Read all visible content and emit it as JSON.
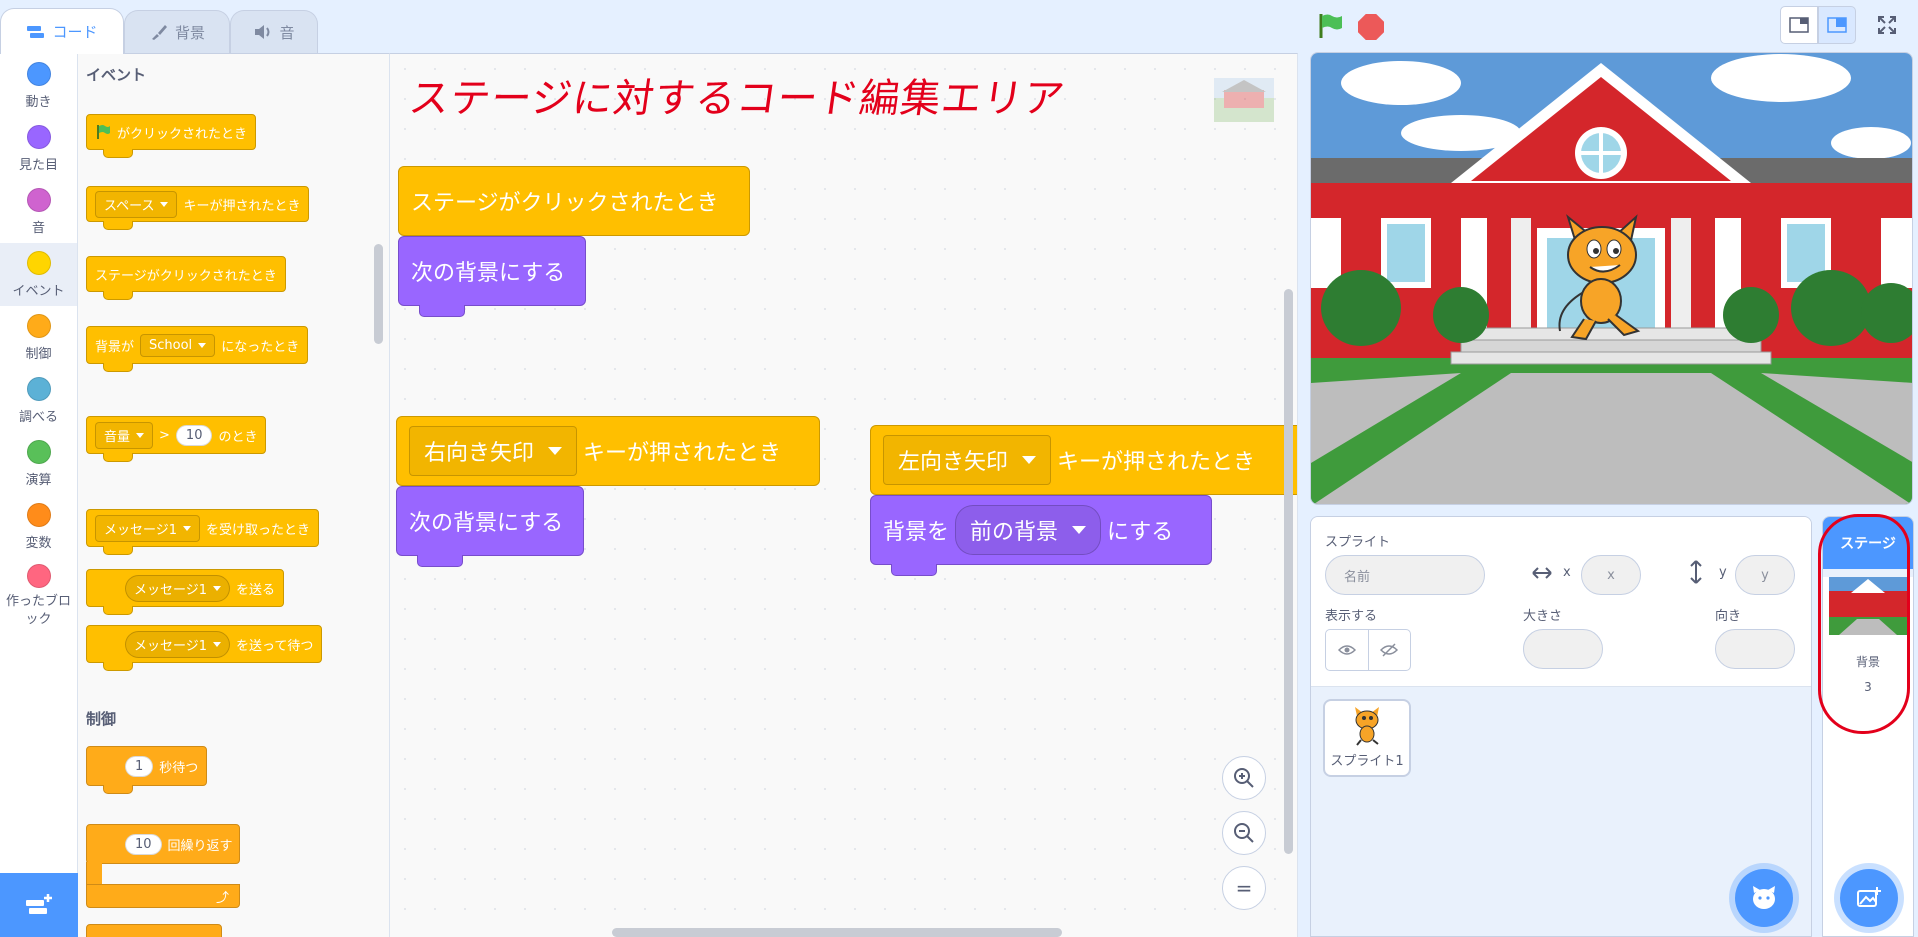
{
  "tabs": [
    {
      "label": "コード",
      "icon": "code-icon",
      "active": true
    },
    {
      "label": "背景",
      "icon": "brush-icon",
      "active": false
    },
    {
      "label": "音",
      "icon": "speaker-icon",
      "active": false
    }
  ],
  "categories": [
    {
      "label": "動き",
      "color": "#4c97ff"
    },
    {
      "label": "見た目",
      "color": "#9966ff"
    },
    {
      "label": "音",
      "color": "#cf63cf"
    },
    {
      "label": "イベント",
      "color": "#ffd500"
    },
    {
      "label": "制御",
      "color": "#ffab19"
    },
    {
      "label": "調べる",
      "color": "#5cb1d6"
    },
    {
      "label": "演算",
      "color": "#59c059"
    },
    {
      "label": "変数",
      "color": "#ff8c1a"
    },
    {
      "label": "作ったブロック",
      "color": "#ff6680"
    }
  ],
  "palette": {
    "events_heading": "イベント",
    "control_heading": "制御",
    "flag_clicked": "がクリックされたとき",
    "key_dd": "スペース",
    "key_pressed": "キーが押されたとき",
    "stage_clicked": "ステージがクリックされたとき",
    "backdrop_prefix": "背景が",
    "backdrop_dd": "School",
    "backdrop_suffix": "になったとき",
    "loudness_dd": "音量",
    "gt": ">",
    "loudness_value": "10",
    "loudness_suffix": "のとき",
    "msg_dd": "メッセージ1",
    "msg_received": "を受け取ったとき",
    "broadcast": "を送る",
    "broadcast_wait": "を送って待つ",
    "wait_value": "1",
    "wait_label": "秒待つ",
    "repeat_value": "10",
    "repeat_label": "回繰り返す"
  },
  "scripts": {
    "annotation": "ステージに対するコード編集エリア",
    "s1_hat": "ステージがクリックされたとき",
    "s1_cmd": "次の背景にする",
    "s2_dd": "右向き矢印",
    "s2_hat": "キーが押されたとき",
    "s2_cmd": "次の背景にする",
    "s3_dd": "左向き矢印",
    "s3_hat": "キーが押されたとき",
    "s3_prefix": "背景を",
    "s3_dd2": "前の背景",
    "s3_suffix": "にする",
    "zoom_reset": "="
  },
  "sprite_info": {
    "sprite_label": "スプライト",
    "name_placeholder": "名前",
    "x_label": "x",
    "x_placeholder": "x",
    "y_label": "y",
    "y_placeholder": "y",
    "show_label": "表示する",
    "size_label": "大きさ",
    "direction_label": "向き"
  },
  "sprites": [
    {
      "name": "スプライト1"
    }
  ],
  "stage_selector": {
    "title": "ステージ",
    "backdrop_label": "背景",
    "backdrop_count": "3"
  },
  "colors": {
    "accent": "#4c97ff",
    "events": "#ffbf00",
    "looks": "#9966ff",
    "annotation": "#e3001b"
  }
}
